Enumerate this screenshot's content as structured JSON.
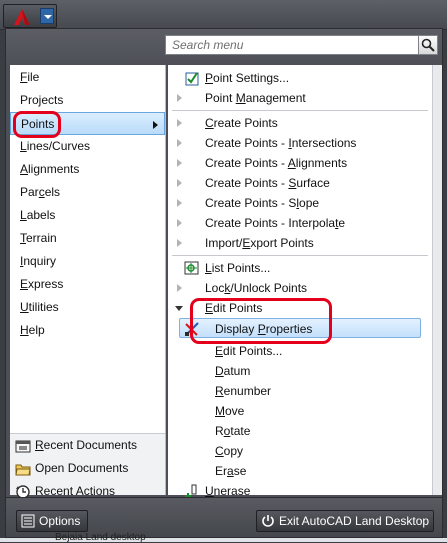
{
  "search": {
    "placeholder": "Search menu"
  },
  "categories": [
    {
      "pre": "",
      "key": "F",
      "post": "ile",
      "name": "category-file"
    },
    {
      "pre": "",
      "key": "",
      "post": "Projects",
      "name": "category-projects"
    },
    {
      "pre": "",
      "key": "",
      "post": "Points",
      "name": "category-points",
      "selected": true
    },
    {
      "pre": "",
      "key": "L",
      "post": "ines/Curves",
      "name": "category-lines-curves"
    },
    {
      "pre": "",
      "key": "A",
      "post": "lignments",
      "name": "category-alignments"
    },
    {
      "pre": "Par",
      "key": "c",
      "post": "els",
      "name": "category-parcels"
    },
    {
      "pre": "",
      "key": "L",
      "post": "abels",
      "name": "category-labels"
    },
    {
      "pre": "",
      "key": "T",
      "post": "errain",
      "name": "category-terrain"
    },
    {
      "pre": "",
      "key": "I",
      "post": "nquiry",
      "name": "category-inquiry"
    },
    {
      "pre": "",
      "key": "E",
      "post": "xpress",
      "name": "category-express"
    },
    {
      "pre": "",
      "key": "U",
      "post": "tilities",
      "name": "category-utilities"
    },
    {
      "pre": "",
      "key": "H",
      "post": "elp",
      "name": "category-help"
    }
  ],
  "recent": [
    {
      "pre": "",
      "key": "R",
      "post": "ecent Documents",
      "icon": "recent-documents-icon"
    },
    {
      "pre": "",
      "key": "",
      "post": "Open Documents",
      "icon": "open-documents-icon"
    },
    {
      "pre": "",
      "key": "",
      "post": "Recent Actions",
      "icon": "recent-actions-icon"
    }
  ],
  "menu": {
    "point_settings": {
      "pre": "",
      "key": "P",
      "post": "oint Settings..."
    },
    "point_management": {
      "pre": "Point ",
      "key": "M",
      "post": "anagement"
    },
    "create_points": {
      "pre": "",
      "key": "C",
      "post": "reate Points"
    },
    "create_intersections": {
      "pre": "Create Points - ",
      "key": "I",
      "post": "ntersections"
    },
    "create_alignments": {
      "pre": "Create Points - ",
      "key": "A",
      "post": "lignments"
    },
    "create_surface": {
      "pre": "Create Points - ",
      "key": "S",
      "post": "urface"
    },
    "create_slope": {
      "pre": "Create Points - S",
      "key": "l",
      "post": "ope"
    },
    "create_interpolate": {
      "pre": "Create Points - Interpola",
      "key": "t",
      "post": "e"
    },
    "import_export": {
      "pre": "Import/",
      "key": "E",
      "post": "xport Points"
    },
    "list_points": {
      "pre": "",
      "key": "L",
      "post": "ist Points..."
    },
    "lock_unlock": {
      "pre": "Loc",
      "key": "k",
      "post": "/Unlock Points"
    },
    "edit_points": {
      "pre": "",
      "key": "E",
      "post": "dit Points"
    },
    "display_properties": {
      "pre": "Display ",
      "key": "P",
      "post": "roperties"
    },
    "edit_points_sub": {
      "pre": "",
      "key": "E",
      "post": "dit Points..."
    },
    "datum": {
      "pre": "",
      "key": "D",
      "post": "atum"
    },
    "renumber": {
      "pre": "",
      "key": "R",
      "post": "enumber"
    },
    "move": {
      "pre": "",
      "key": "M",
      "post": "ove"
    },
    "rotate": {
      "pre": "R",
      "key": "o",
      "post": "tate"
    },
    "copy": {
      "pre": "",
      "key": "C",
      "post": "opy"
    },
    "erase": {
      "pre": "Er",
      "key": "a",
      "post": "se"
    },
    "unerase": {
      "pre": "",
      "key": "U",
      "post": "nerase"
    }
  },
  "buttons": {
    "options": "Options",
    "exit": "Exit AutoCAD Land Desktop"
  },
  "taskbar": {
    "label": "Bejaia Land desktop"
  },
  "colors": {
    "accent": "#6aa6de",
    "annotation": "#e4001b",
    "chrome": "#4c4f55"
  }
}
